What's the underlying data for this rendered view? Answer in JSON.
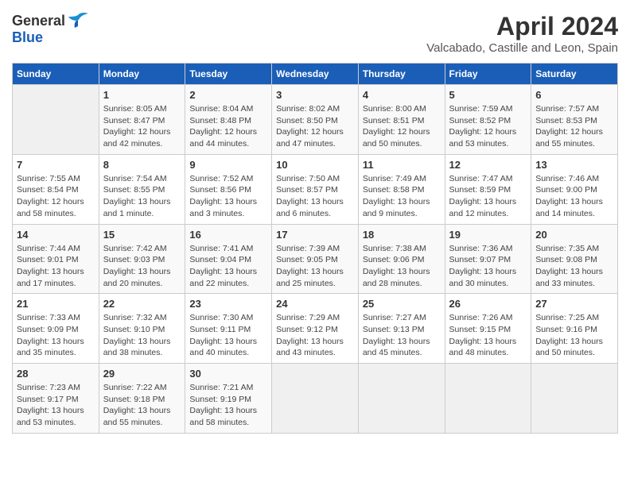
{
  "header": {
    "logo_general": "General",
    "logo_blue": "Blue",
    "title": "April 2024",
    "subtitle": "Valcabado, Castille and Leon, Spain"
  },
  "weekdays": [
    "Sunday",
    "Monday",
    "Tuesday",
    "Wednesday",
    "Thursday",
    "Friday",
    "Saturday"
  ],
  "weeks": [
    [
      {
        "day": "",
        "info": ""
      },
      {
        "day": "1",
        "info": "Sunrise: 8:05 AM\nSunset: 8:47 PM\nDaylight: 12 hours\nand 42 minutes."
      },
      {
        "day": "2",
        "info": "Sunrise: 8:04 AM\nSunset: 8:48 PM\nDaylight: 12 hours\nand 44 minutes."
      },
      {
        "day": "3",
        "info": "Sunrise: 8:02 AM\nSunset: 8:50 PM\nDaylight: 12 hours\nand 47 minutes."
      },
      {
        "day": "4",
        "info": "Sunrise: 8:00 AM\nSunset: 8:51 PM\nDaylight: 12 hours\nand 50 minutes."
      },
      {
        "day": "5",
        "info": "Sunrise: 7:59 AM\nSunset: 8:52 PM\nDaylight: 12 hours\nand 53 minutes."
      },
      {
        "day": "6",
        "info": "Sunrise: 7:57 AM\nSunset: 8:53 PM\nDaylight: 12 hours\nand 55 minutes."
      }
    ],
    [
      {
        "day": "7",
        "info": "Sunrise: 7:55 AM\nSunset: 8:54 PM\nDaylight: 12 hours\nand 58 minutes."
      },
      {
        "day": "8",
        "info": "Sunrise: 7:54 AM\nSunset: 8:55 PM\nDaylight: 13 hours\nand 1 minute."
      },
      {
        "day": "9",
        "info": "Sunrise: 7:52 AM\nSunset: 8:56 PM\nDaylight: 13 hours\nand 3 minutes."
      },
      {
        "day": "10",
        "info": "Sunrise: 7:50 AM\nSunset: 8:57 PM\nDaylight: 13 hours\nand 6 minutes."
      },
      {
        "day": "11",
        "info": "Sunrise: 7:49 AM\nSunset: 8:58 PM\nDaylight: 13 hours\nand 9 minutes."
      },
      {
        "day": "12",
        "info": "Sunrise: 7:47 AM\nSunset: 8:59 PM\nDaylight: 13 hours\nand 12 minutes."
      },
      {
        "day": "13",
        "info": "Sunrise: 7:46 AM\nSunset: 9:00 PM\nDaylight: 13 hours\nand 14 minutes."
      }
    ],
    [
      {
        "day": "14",
        "info": "Sunrise: 7:44 AM\nSunset: 9:01 PM\nDaylight: 13 hours\nand 17 minutes."
      },
      {
        "day": "15",
        "info": "Sunrise: 7:42 AM\nSunset: 9:03 PM\nDaylight: 13 hours\nand 20 minutes."
      },
      {
        "day": "16",
        "info": "Sunrise: 7:41 AM\nSunset: 9:04 PM\nDaylight: 13 hours\nand 22 minutes."
      },
      {
        "day": "17",
        "info": "Sunrise: 7:39 AM\nSunset: 9:05 PM\nDaylight: 13 hours\nand 25 minutes."
      },
      {
        "day": "18",
        "info": "Sunrise: 7:38 AM\nSunset: 9:06 PM\nDaylight: 13 hours\nand 28 minutes."
      },
      {
        "day": "19",
        "info": "Sunrise: 7:36 AM\nSunset: 9:07 PM\nDaylight: 13 hours\nand 30 minutes."
      },
      {
        "day": "20",
        "info": "Sunrise: 7:35 AM\nSunset: 9:08 PM\nDaylight: 13 hours\nand 33 minutes."
      }
    ],
    [
      {
        "day": "21",
        "info": "Sunrise: 7:33 AM\nSunset: 9:09 PM\nDaylight: 13 hours\nand 35 minutes."
      },
      {
        "day": "22",
        "info": "Sunrise: 7:32 AM\nSunset: 9:10 PM\nDaylight: 13 hours\nand 38 minutes."
      },
      {
        "day": "23",
        "info": "Sunrise: 7:30 AM\nSunset: 9:11 PM\nDaylight: 13 hours\nand 40 minutes."
      },
      {
        "day": "24",
        "info": "Sunrise: 7:29 AM\nSunset: 9:12 PM\nDaylight: 13 hours\nand 43 minutes."
      },
      {
        "day": "25",
        "info": "Sunrise: 7:27 AM\nSunset: 9:13 PM\nDaylight: 13 hours\nand 45 minutes."
      },
      {
        "day": "26",
        "info": "Sunrise: 7:26 AM\nSunset: 9:15 PM\nDaylight: 13 hours\nand 48 minutes."
      },
      {
        "day": "27",
        "info": "Sunrise: 7:25 AM\nSunset: 9:16 PM\nDaylight: 13 hours\nand 50 minutes."
      }
    ],
    [
      {
        "day": "28",
        "info": "Sunrise: 7:23 AM\nSunset: 9:17 PM\nDaylight: 13 hours\nand 53 minutes."
      },
      {
        "day": "29",
        "info": "Sunrise: 7:22 AM\nSunset: 9:18 PM\nDaylight: 13 hours\nand 55 minutes."
      },
      {
        "day": "30",
        "info": "Sunrise: 7:21 AM\nSunset: 9:19 PM\nDaylight: 13 hours\nand 58 minutes."
      },
      {
        "day": "",
        "info": ""
      },
      {
        "day": "",
        "info": ""
      },
      {
        "day": "",
        "info": ""
      },
      {
        "day": "",
        "info": ""
      }
    ]
  ]
}
